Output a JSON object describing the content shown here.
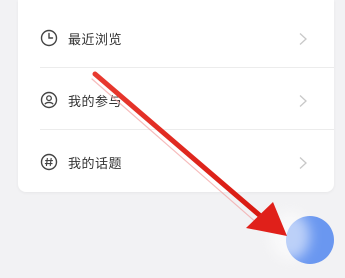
{
  "menu": {
    "items": [
      {
        "label": "最近浏览",
        "icon": "clock-icon"
      },
      {
        "label": "我的参与",
        "icon": "participation-icon"
      },
      {
        "label": "我的话题",
        "icon": "hashtag-icon"
      }
    ]
  },
  "fab": {
    "icon": "floating-action-button",
    "color": "#5b8df0"
  },
  "annotation": {
    "color": "#e0201a"
  }
}
